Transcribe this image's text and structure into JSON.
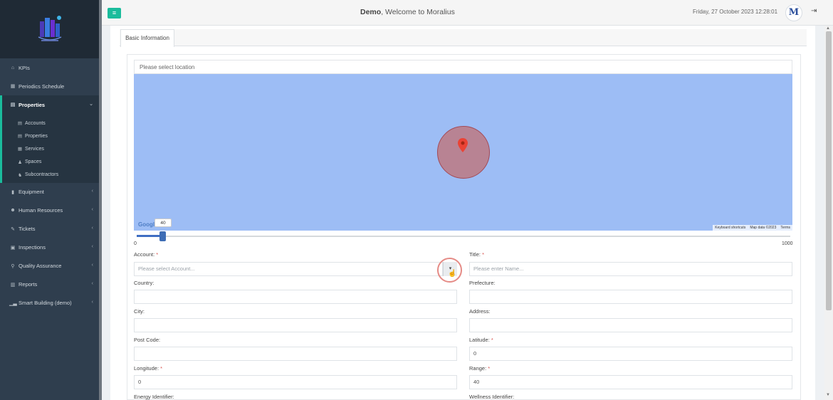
{
  "sidebar": {
    "items": [
      {
        "label": "KPIs",
        "icon": "home-icon",
        "glyph": "⌂"
      },
      {
        "label": "Periodics Schedule",
        "icon": "calendar-icon",
        "glyph": "▦"
      },
      {
        "label": "Properties",
        "icon": "building-icon",
        "glyph": "▤",
        "active": true
      },
      {
        "label": "Equipment",
        "icon": "equipment-icon",
        "glyph": "▮"
      },
      {
        "label": "Human Resources",
        "icon": "users-icon",
        "glyph": "☻"
      },
      {
        "label": "Tickets",
        "icon": "ticket-icon",
        "glyph": "✎"
      },
      {
        "label": "Inspections",
        "icon": "inspection-icon",
        "glyph": "▣"
      },
      {
        "label": "Quality Assurance",
        "icon": "search-icon",
        "glyph": "⚲"
      },
      {
        "label": "Reports",
        "icon": "reports-icon",
        "glyph": "▥"
      },
      {
        "label": "Smart Building (demo)",
        "icon": "chart-icon",
        "glyph": "▁▃"
      }
    ],
    "sub_items": [
      {
        "label": "Accounts",
        "icon": "account-icon",
        "glyph": "▤"
      },
      {
        "label": "Properties",
        "icon": "property-icon",
        "glyph": "▤"
      },
      {
        "label": "Services",
        "icon": "services-icon",
        "glyph": "▦"
      },
      {
        "label": "Spaces",
        "icon": "spaces-icon",
        "glyph": "♟"
      },
      {
        "label": "Subcontractors",
        "icon": "subcontractor-icon",
        "glyph": "♞"
      }
    ]
  },
  "header": {
    "brand": "Demo",
    "welcome": ", Welcome to Moralius",
    "datetime": "Friday, 27 October 2023 12:28:01",
    "avatar": "M"
  },
  "tabs": [
    {
      "label": "Basic Information"
    }
  ],
  "map": {
    "location_label": "Please select location",
    "google": "Google",
    "footer": [
      "Keyboard shortcuts",
      "Map data ©2023",
      "Terms"
    ]
  },
  "slider": {
    "value": "40",
    "min": "0",
    "max": "1000",
    "fraction": 0.04
  },
  "form": {
    "account_label": "Account:",
    "account_placeholder": "Please select Account...",
    "title_label": "Title:",
    "title_placeholder": "Please enter Name...",
    "country_label": "Country:",
    "prefecture_label": "Prefecture:",
    "city_label": "City:",
    "address_label": "Address:",
    "postcode_label": "Post Code:",
    "latitude_label": "Latitude:",
    "latitude_value": "0",
    "longitude_label": "Longitude:",
    "longitude_value": "0",
    "range_label": "Range:",
    "range_value": "40",
    "energy_label": "Energy Identifier:",
    "wellness_label": "Wellness Identifier:",
    "required": "*"
  },
  "colors": {
    "accent": "#1abc9c",
    "sidebar": "#2f3e4e",
    "map": "#9dbdf5",
    "slider": "#3f6ec2"
  }
}
